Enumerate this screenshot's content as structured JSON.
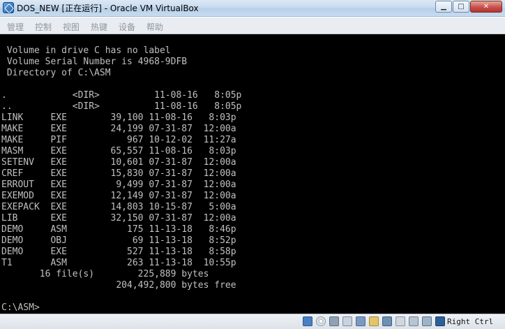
{
  "window": {
    "title": "DOS_NEW [正在运行] - Oracle VM VirtualBox",
    "controls": {
      "minimize": "▁",
      "maximize": "□",
      "close": "✕"
    }
  },
  "menu": [
    "管理",
    "控制",
    "视图",
    "热键",
    "设备",
    "帮助"
  ],
  "console": {
    "volume_label": " Volume in drive C has no label",
    "serial": " Volume Serial Number is 4968-9DFB",
    "directory": " Directory of C:\\ASM",
    "entries": [
      ".            <DIR>          11-08-16   8:05p",
      "..           <DIR>          11-08-16   8:05p",
      "LINK     EXE        39,100 11-08-16   8:03p",
      "MAKE     EXE        24,199 07-31-87  12:00a",
      "MAKE     PIF           967 10-12-02  11:27a",
      "MASM     EXE        65,557 11-08-16   8:03p",
      "SETENV   EXE        10,601 07-31-87  12:00a",
      "CREF     EXE        15,830 07-31-87  12:00a",
      "ERROUT   EXE         9,499 07-31-87  12:00a",
      "EXEMOD   EXE        12,149 07-31-87  12:00a",
      "EXEPACK  EXE        14,803 10-15-87   5:00a",
      "LIB      EXE        32,150 07-31-87  12:00a",
      "DEMO     ASM           175 11-13-18   8:46p",
      "DEMO     OBJ            69 11-13-18   8:52p",
      "DEMO     EXE           527 11-13-18   8:58p",
      "T1       ASM           263 11-13-18  10:55p"
    ],
    "summary_files": "       16 file(s)        225,889 bytes",
    "summary_free": "                     204,492,800 bytes free",
    "prompt": "C:\\ASM>"
  },
  "statusbar": {
    "host_key": "Right Ctrl",
    "icons": [
      "hard-disk-icon",
      "optical-drive-icon",
      "audio-icon",
      "usb-icon",
      "shared-folders-icon",
      "display-icon",
      "video-capture-icon",
      "network-icon",
      "mouse-integration-icon",
      "cpu-icon",
      "host-key-icon"
    ]
  }
}
